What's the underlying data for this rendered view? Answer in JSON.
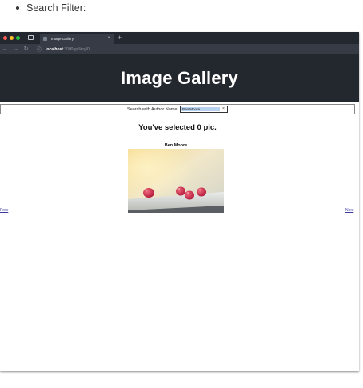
{
  "caption": {
    "text": "Search Filter:"
  },
  "browser": {
    "tab_title": "Image Gallery",
    "tab_close": "×",
    "new_tab": "+",
    "nav": {
      "back": "←",
      "forward": "→",
      "reload": "↻",
      "info": "ⓘ"
    },
    "url_host": "localhost",
    "url_path": ":3000/gallery/0"
  },
  "app": {
    "title": "Image Gallery",
    "search": {
      "label": "Search with Author Name:",
      "value": "Ben Moore",
      "clear": "×"
    },
    "selection_text": "You've selected 0 pic.",
    "card": {
      "author": "Ben Moore"
    },
    "pager": {
      "prev": "Prev",
      "next": "Next"
    }
  },
  "colors": {
    "traffic_red": "#ff5f57",
    "traffic_yellow": "#febc2e",
    "traffic_green": "#28c840",
    "header_bg": "#23272e",
    "search_highlight": "#b8d2f0",
    "link": "#3a3aa0"
  }
}
